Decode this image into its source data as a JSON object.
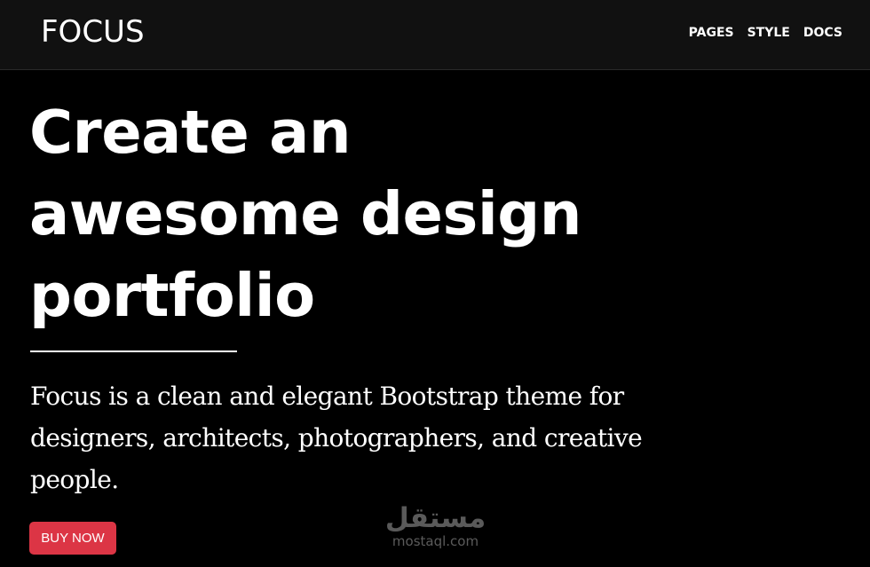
{
  "navbar": {
    "brand": "FOCUS",
    "links": [
      {
        "label": "PAGES"
      },
      {
        "label": "STYLE"
      },
      {
        "label": "DOCS"
      }
    ]
  },
  "hero": {
    "headline": "Create an awesome design portfolio",
    "lead": "Focus is a clean and elegant Bootstrap theme for designers, architects, photographers, and creative people.",
    "cta_label": "BUY NOW"
  },
  "watermark": {
    "logo_text": "مستقل",
    "url": "mostaql.com"
  },
  "colors": {
    "page_background": "#000000",
    "navbar_background": "#111111",
    "text": "#ffffff",
    "cta_background": "#dc3545"
  }
}
